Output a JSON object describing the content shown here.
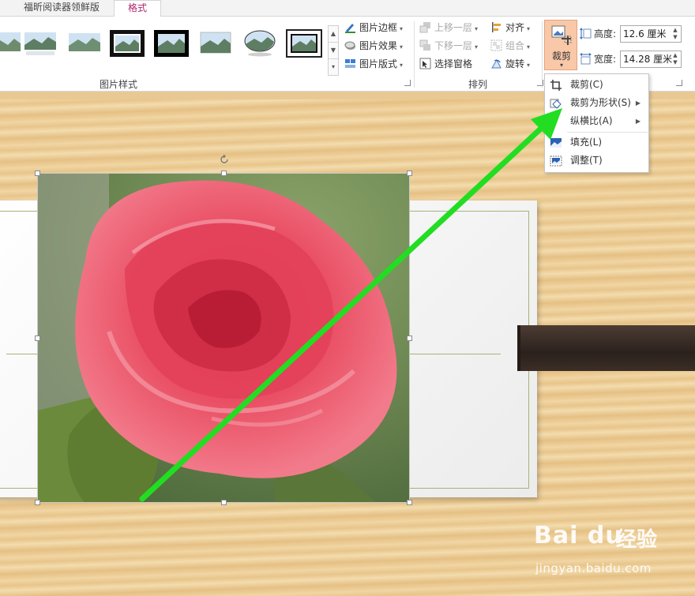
{
  "tabs": [
    {
      "label": "福昕阅读器领鲜版"
    },
    {
      "label": "格式"
    }
  ],
  "picture_styles": {
    "group_label": "图片样式",
    "border_label": "图片边框",
    "effects_label": "图片效果",
    "layout_label": "图片版式"
  },
  "arrange": {
    "group_label": "排列",
    "bring_forward": "上移一层",
    "send_backward": "下移一层",
    "selection_pane": "选择窗格",
    "align": "对齐",
    "group": "组合",
    "rotate": "旋转"
  },
  "size": {
    "crop_label": "裁剪",
    "height_label": "高度:",
    "height_value": "12.6 厘米",
    "width_label": "宽度:",
    "width_value": "14.28 厘米"
  },
  "crop_menu": [
    {
      "label": "裁剪(C)",
      "icon": "crop-icon"
    },
    {
      "label": "裁剪为形状(S)",
      "icon": "shape-crop-icon",
      "submenu": true
    },
    {
      "label": "纵横比(A)",
      "icon": "",
      "submenu": true
    },
    {
      "label": "填充(L)",
      "icon": "fill-icon"
    },
    {
      "label": "调整(T)",
      "icon": "fit-icon"
    }
  ],
  "colors": {
    "crop_highlight": "#f8c8a8",
    "active_tab": "#b0266e",
    "arrow": "#22dd22"
  },
  "watermark": {
    "brand": "Bai du",
    "cn": "经验",
    "url": "jingyan.baidu.com"
  }
}
